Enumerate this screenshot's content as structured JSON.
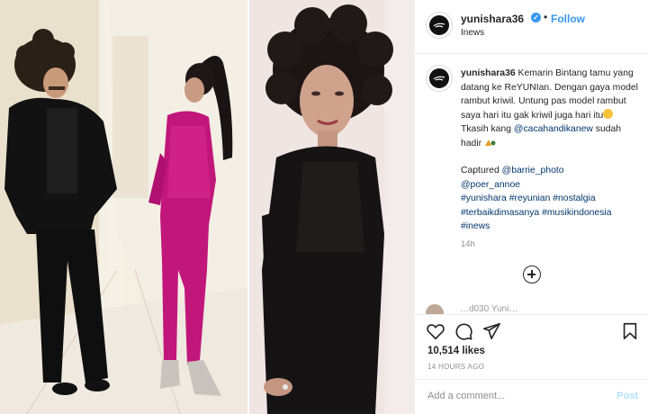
{
  "post": {
    "username": "yunishara36",
    "verified": true,
    "follow_label": "Follow",
    "separator": "•",
    "subtitle": "Inews"
  },
  "caption": {
    "username": "yunishara36",
    "text_1": "Kemarin Bintang tamu yang datang ke ReYUNIan. Dengan gaya model rambut kriwil. Untung pas model rambut saya hari itu gak kriwil juga hari itu",
    "text_2": "Tkasih kang ",
    "mention_1": "@cacahandikanew",
    "text_3": " sudah hadir",
    "text_4": "Captured ",
    "mention_2": "@barrie_photo",
    "mention_3": "@poer_annoe",
    "hashtags_1": "#yunishara #reyunian #nostalgia",
    "hashtags_2": "#terbaikdimasanya #musikindonesia",
    "hashtags_3": "#inews",
    "relative_time": "14h"
  },
  "comment_peek": {
    "text": "…d030 Yuni…"
  },
  "actions": {
    "icons": [
      "heart-icon",
      "comment-icon",
      "share-icon",
      "bookmark-icon"
    ],
    "likes": "10,514 likes",
    "timestamp": "14 HOURS AGO"
  },
  "comment_box": {
    "placeholder": "Add a comment...",
    "post_label": "Post"
  },
  "colors": {
    "accent": "#3897f0",
    "link": "#00376b",
    "muted": "#8e8e8e",
    "post_disabled": "#b2dffc",
    "border": "#efefef"
  }
}
